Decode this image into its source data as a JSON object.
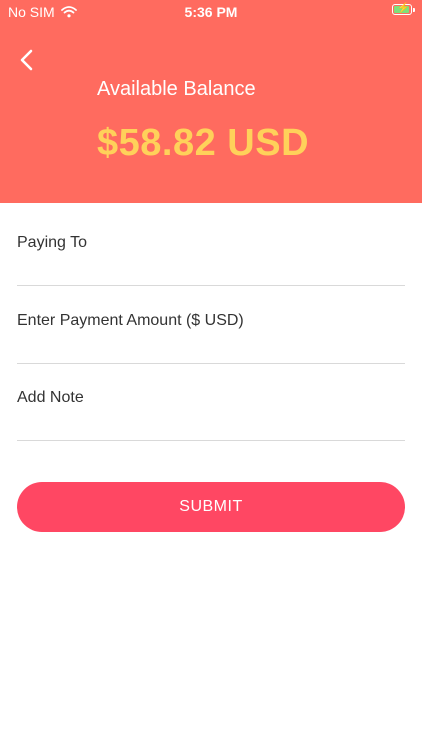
{
  "status_bar": {
    "carrier": "No SIM",
    "time": "5:36 PM",
    "icons": [
      "wifi-icon",
      "battery-charging-icon"
    ],
    "battery_level": 0.85
  },
  "header": {
    "back_icon": "chevron-left-icon",
    "balance_label": "Available Balance",
    "balance_amount": "$58.82 USD"
  },
  "form": {
    "paying_to_label": "Paying To",
    "amount_label": "Enter Payment Amount ($ USD)",
    "note_label": "Add Note"
  },
  "submit_label": "SUBMIT",
  "colors": {
    "header_bg": "#ff6b5f",
    "balance_amount": "#ffd15a",
    "submit_bg": "#ff4763",
    "divider": "#d9d9d9"
  }
}
